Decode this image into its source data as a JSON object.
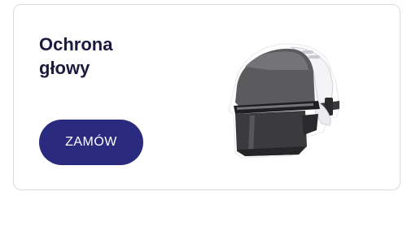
{
  "card": {
    "title_line1": "Ochrona",
    "title_line2": "głowy",
    "order_label": "ZAMÓW",
    "image_icon": "safety-helmet-with-visor"
  },
  "colors": {
    "title": "#1c1b3f",
    "button_bg": "#2a2b7f",
    "button_text": "#ffffff",
    "card_border": "#d9dbe3"
  }
}
